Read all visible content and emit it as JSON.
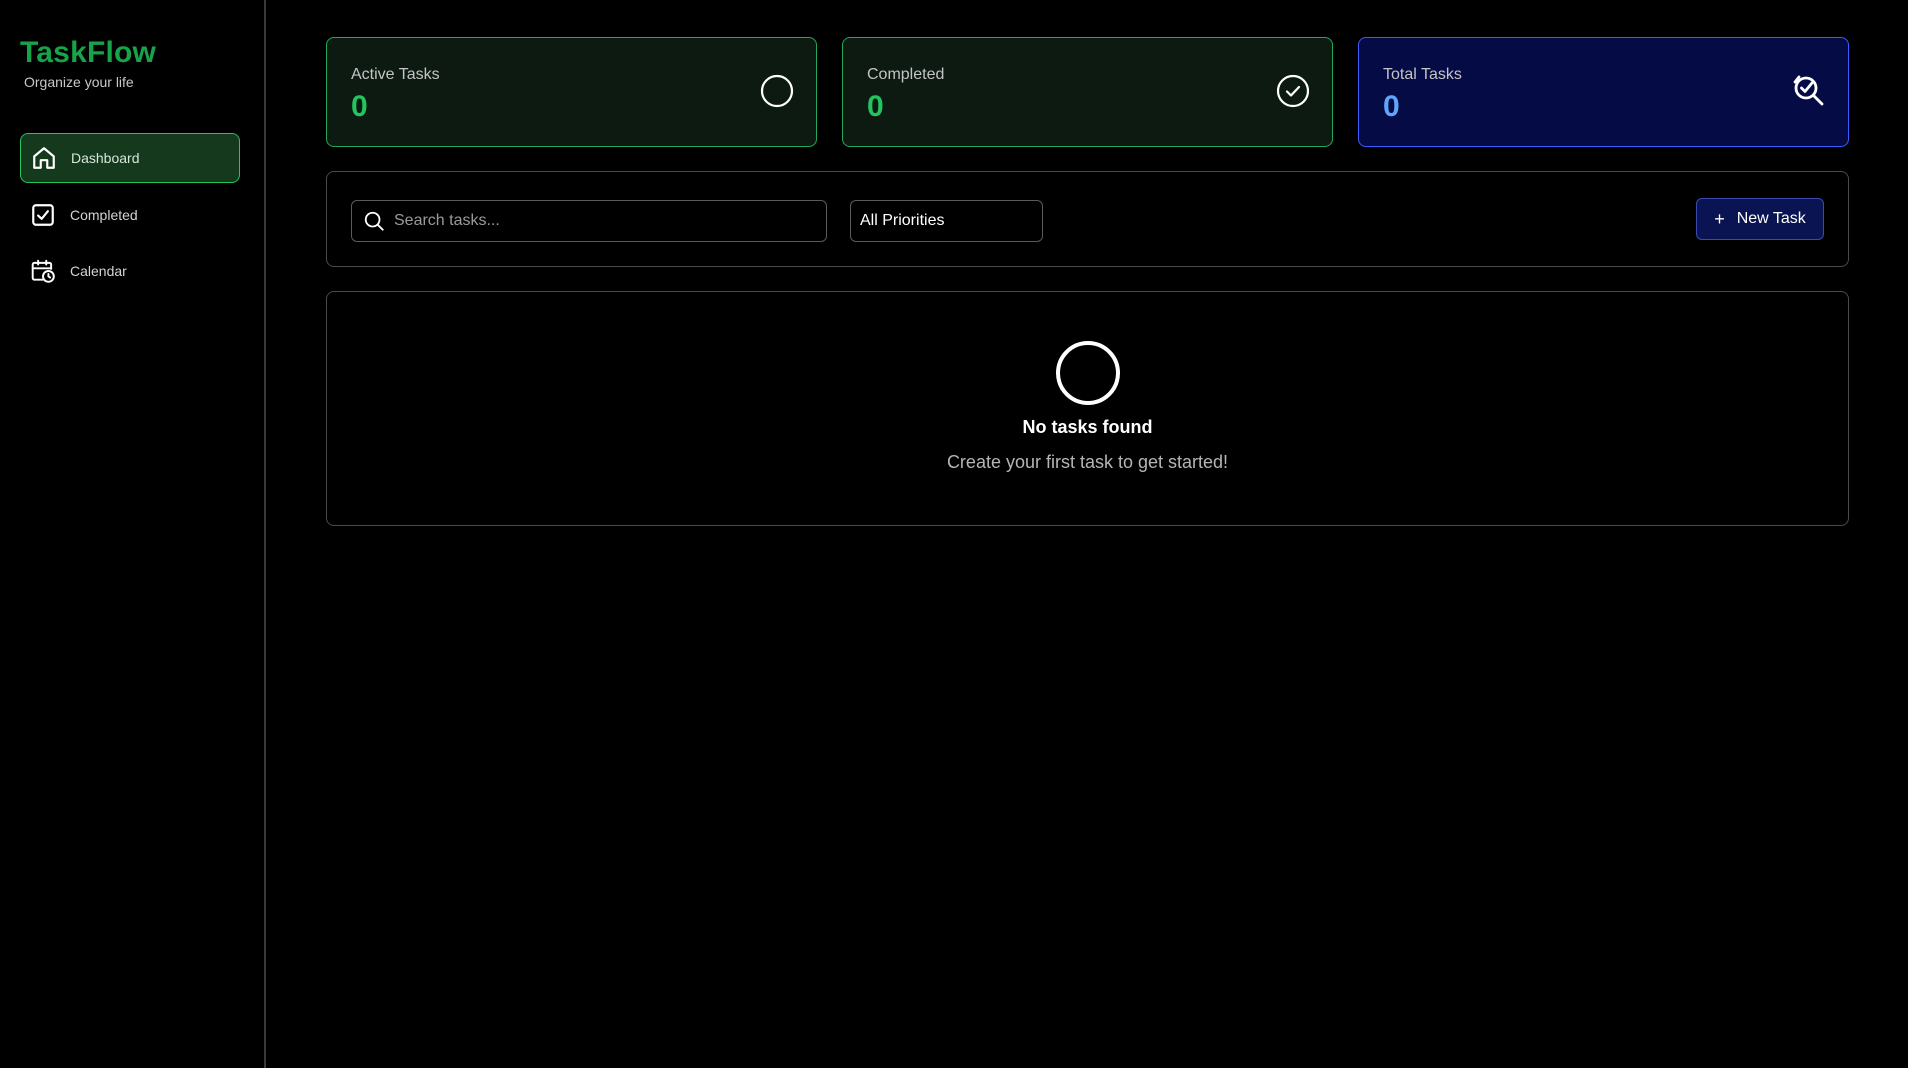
{
  "brand": {
    "title": "TaskFlow",
    "subtitle": "Organize your life",
    "accent_color": "#16a34a"
  },
  "sidebar": {
    "items": [
      {
        "label": "Dashboard",
        "icon": "home-icon",
        "active": true
      },
      {
        "label": "Completed",
        "icon": "checkbox-icon",
        "active": false
      },
      {
        "label": "Calendar",
        "icon": "calendar-clock-icon",
        "active": false
      }
    ]
  },
  "stats": [
    {
      "label": "Active Tasks",
      "value": "0",
      "icon": "circle-icon",
      "color": "#22c55e"
    },
    {
      "label": "Completed",
      "value": "0",
      "icon": "check-circle-icon",
      "color": "#22c55e"
    },
    {
      "label": "Total Tasks",
      "value": "0",
      "icon": "search-check-icon",
      "color": "#60a5fa"
    }
  ],
  "toolbar": {
    "search_placeholder": "Search tasks...",
    "search_value": "",
    "priority_selected": "All Priorities",
    "new_task_label": "New Task"
  },
  "empty_state": {
    "icon": "circle-icon",
    "title": "No tasks found",
    "subtitle": "Create your first task to get started!"
  }
}
